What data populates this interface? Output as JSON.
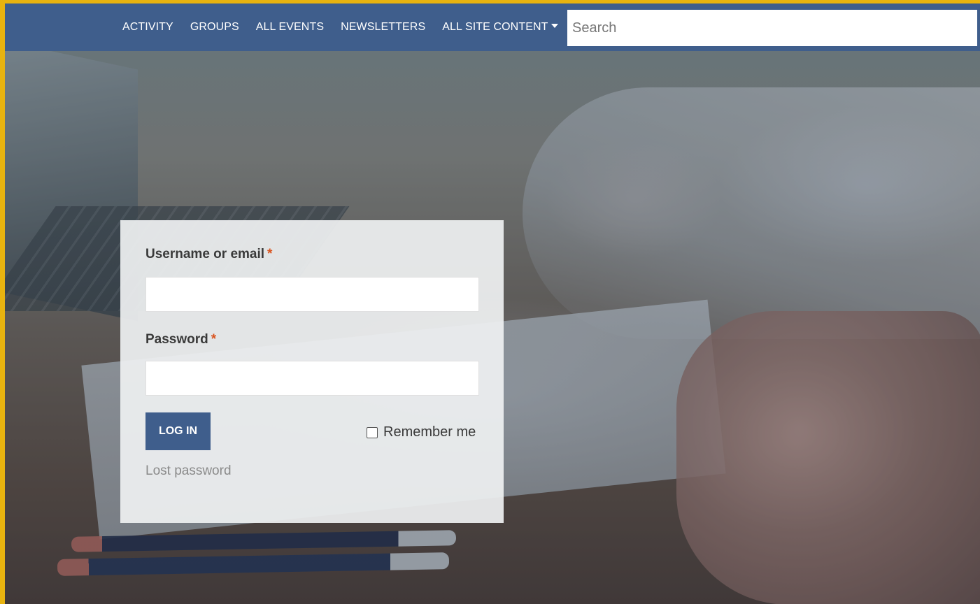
{
  "nav": {
    "items": [
      {
        "label": "ACTIVITY"
      },
      {
        "label": "GROUPS"
      },
      {
        "label": "ALL EVENTS"
      },
      {
        "label": "NEWSLETTERS"
      },
      {
        "label": "ALL SITE CONTENT"
      }
    ],
    "dropdown_icon": "caret-down-icon",
    "search_placeholder": "Search"
  },
  "login": {
    "username_label": "Username or email",
    "password_label": "Password",
    "required_marker": "*",
    "username_value": "",
    "password_value": "",
    "submit_label": "LOG IN",
    "remember_label": "Remember me",
    "remember_checked": false,
    "lost_password_label": "Lost password"
  },
  "colors": {
    "accent": "#3f5e8c",
    "required": "#d9531e",
    "frame_border": "#e8b30f"
  }
}
